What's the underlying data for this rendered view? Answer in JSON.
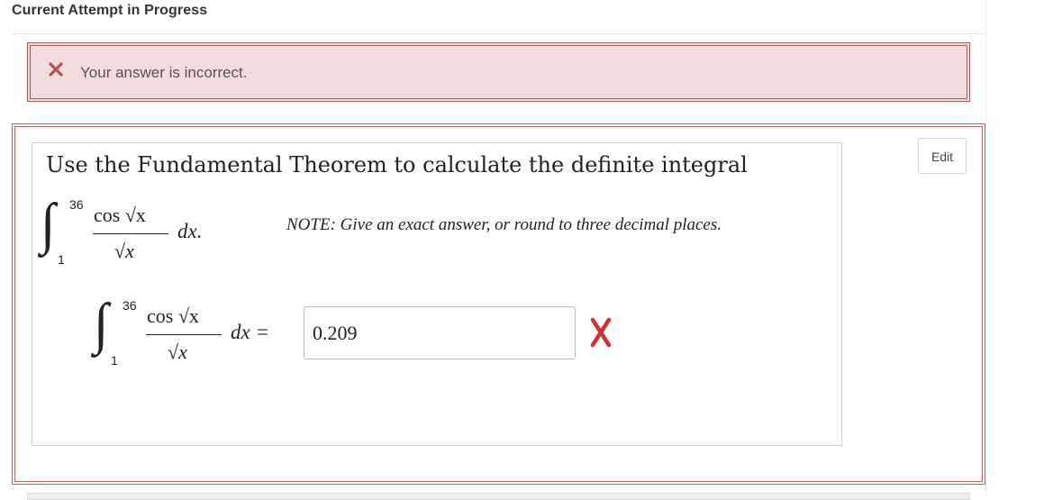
{
  "header": {
    "title": "Current Attempt in Progress"
  },
  "feedback": {
    "icon": "close-icon",
    "message": "Your answer is incorrect.",
    "color": "#b7514d"
  },
  "question": {
    "edit_label": "Edit",
    "prompt": "Use the Fundamental Theorem to calculate the definite integral",
    "integral": {
      "lower": "1",
      "upper": "36",
      "numerator": "cos √x",
      "denominator": "√x",
      "differential": "dx."
    },
    "note": "NOTE: Give an exact answer, or round to three decimal places.",
    "answer_line": {
      "lower": "1",
      "upper": "36",
      "numerator": "cos √x",
      "denominator": "√x",
      "differential": "dx ="
    },
    "answer_value": "0.209",
    "result_icon": "incorrect-x-icon",
    "result_color": "#d32f2f"
  }
}
